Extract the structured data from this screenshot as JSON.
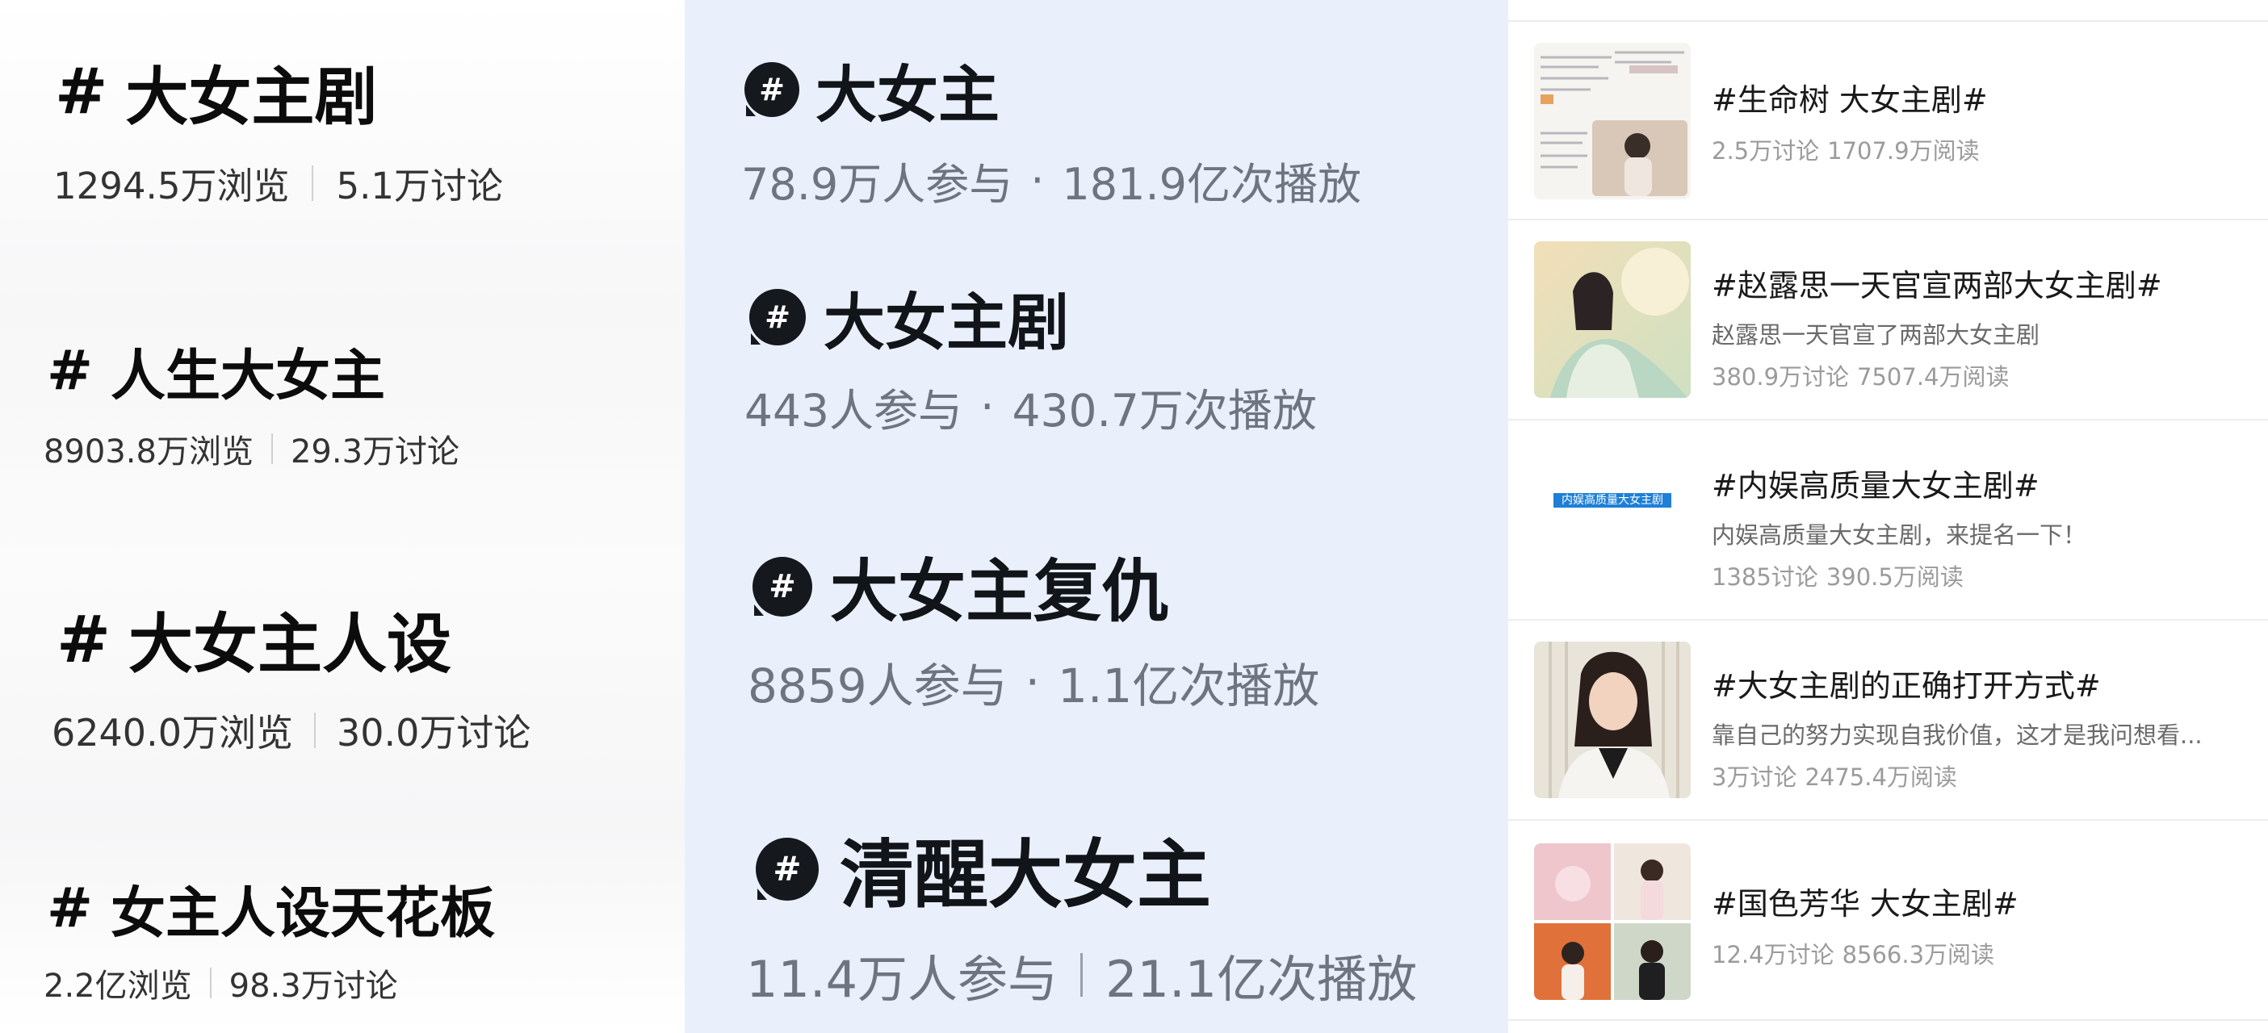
{
  "left_topics": [
    {
      "hash": "#",
      "title": "大女主剧",
      "views": "1294.5万浏览",
      "discussions": "5.1万讨论"
    },
    {
      "hash": "#",
      "title": "人生大女主",
      "views": "8903.8万浏览",
      "discussions": "29.3万讨论"
    },
    {
      "hash": "#",
      "title": "大女主人设",
      "views": "6240.0万浏览",
      "discussions": "30.0万讨论"
    },
    {
      "hash": "#",
      "title": "女主人设天花板",
      "views": "2.2亿浏览",
      "discussions": "98.3万讨论"
    }
  ],
  "middle_topics": [
    {
      "icon": "#",
      "title": "大女主",
      "participants": "78.9万人参与",
      "separator": "·",
      "plays": "181.9亿次播放"
    },
    {
      "icon": "#",
      "title": "大女主剧",
      "participants": "443人参与",
      "separator": "·",
      "plays": "430.7万次播放"
    },
    {
      "icon": "#",
      "title": "大女主复仇",
      "participants": "8859人参与",
      "separator": "·",
      "plays": "1.1亿次播放"
    },
    {
      "icon": "#",
      "title": "清醒大女主",
      "participants": "11.4万人参与",
      "separator": "|",
      "plays": "21.1亿次播放"
    }
  ],
  "right_topics": [
    {
      "title": "#生命树 大女主剧#",
      "desc": "",
      "discussions": "2.5万讨论",
      "reads": "1707.9万阅读"
    },
    {
      "title": "#赵露思一天官宣两部大女主剧#",
      "desc": "赵露思一天官宣了两部大女主剧",
      "discussions": "380.9万讨论",
      "reads": "7507.4万阅读"
    },
    {
      "title": "#内娱高质量大女主剧#",
      "desc": "内娱高质量大女主剧，来提名一下！",
      "discussions": "1385讨论",
      "reads": "390.5万阅读",
      "thumb_text": "内娱高质量大女主剧"
    },
    {
      "title": "#大女主剧的正确打开方式#",
      "desc": "靠自己的努力实现自我价值，这才是我问想看...",
      "discussions": "3万讨论",
      "reads": "2475.4万阅读"
    },
    {
      "title": "#国色芳华 大女主剧#",
      "desc": "",
      "discussions": "12.4万讨论",
      "reads": "8566.3万阅读"
    }
  ],
  "colors": {
    "middle_bg": "#eaf0fb",
    "hashtag_bubble": "#15181d",
    "thumb_label_bg": "#1e7fd6"
  }
}
